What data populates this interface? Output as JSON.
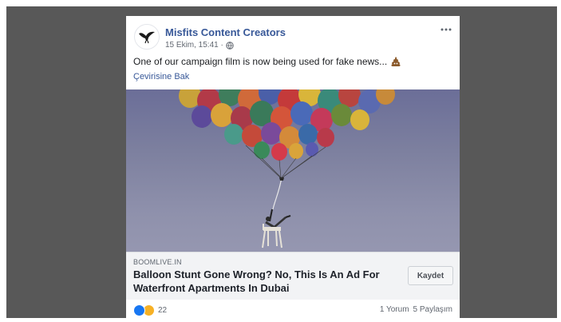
{
  "colors": {
    "backdrop": "#585858",
    "link_blue": "#385898",
    "like_blue": "#1877f2",
    "haha_yellow": "#f7b125"
  },
  "post": {
    "page_name": "Misfits Content Creators",
    "timestamp": "15 Ekim, 15:41 ·",
    "privacy_icon": "globe-icon",
    "more_icon": "ellipsis-icon",
    "text": "One of our campaign film is now being used for fake news...",
    "text_emoji": "poop-emoji",
    "see_translation": "Çevirisine Bak",
    "image": "balloon-chair-photo"
  },
  "link_preview": {
    "domain": "BOOMLIVE.IN",
    "title": "Balloon Stunt Gone Wrong? No, This Is An Ad For Waterfront Apartments In Dubai",
    "save_label": "Kaydet"
  },
  "footer": {
    "reaction_icons": [
      "like-icon",
      "haha-icon"
    ],
    "reaction_count": "22",
    "comments": "1 Yorum",
    "shares": "5 Paylaşım"
  }
}
